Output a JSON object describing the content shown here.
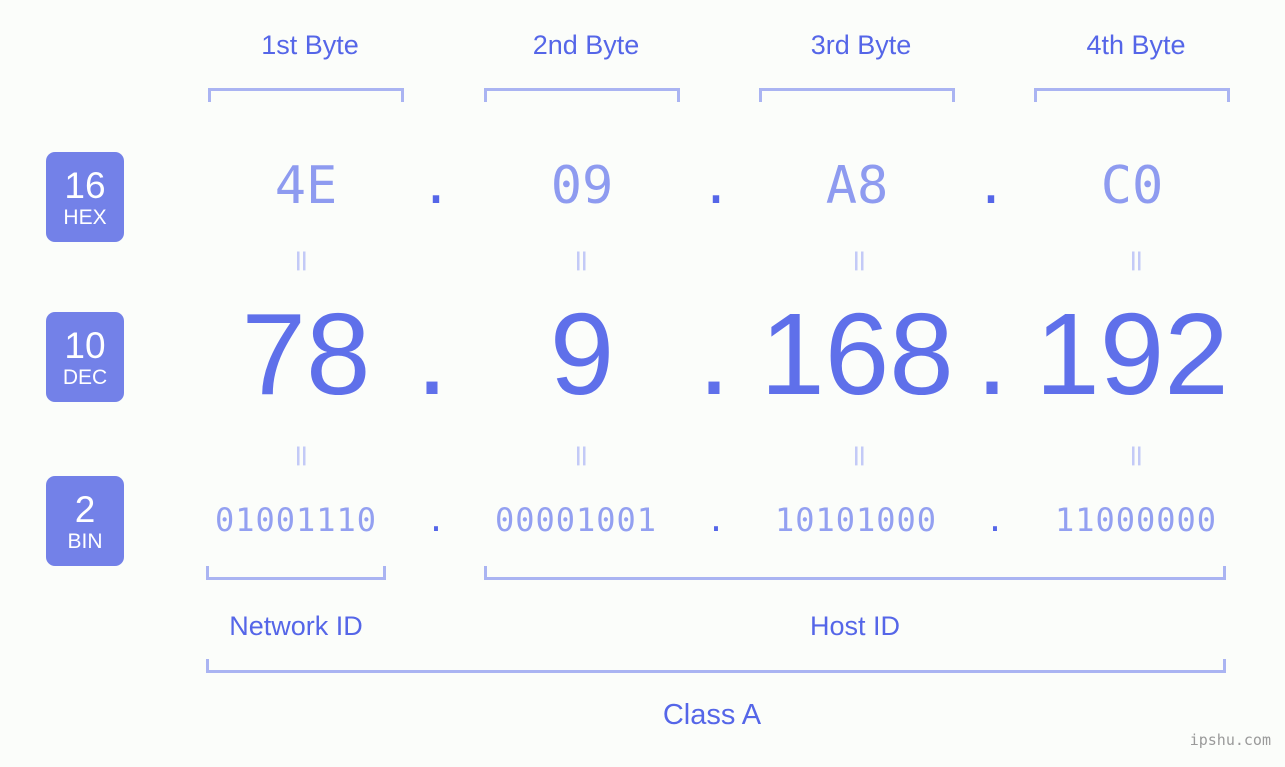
{
  "page": {
    "background_color": "#fbfdfa",
    "accent_color": "#5566e8",
    "badge_color": "#7381e8",
    "bracket_color": "#aab4f2",
    "muted_color": "#8e9bf0"
  },
  "byte_headers": [
    {
      "label": "1st Byte"
    },
    {
      "label": "2nd Byte"
    },
    {
      "label": "3rd Byte"
    },
    {
      "label": "4th Byte"
    }
  ],
  "radix_badges": [
    {
      "number": "16",
      "unit": "HEX"
    },
    {
      "number": "10",
      "unit": "DEC"
    },
    {
      "number": "2",
      "unit": "BIN"
    }
  ],
  "rows": {
    "hex": {
      "values": [
        "4E",
        "09",
        "A8",
        "C0"
      ],
      "separator": "."
    },
    "dec": {
      "values": [
        "78",
        "9",
        "168",
        "192"
      ],
      "separator": "."
    },
    "bin": {
      "values": [
        "01001110",
        "00001001",
        "10101000",
        "11000000"
      ],
      "separator": "."
    }
  },
  "equality_mark": "=",
  "sections": {
    "network_id": "Network ID",
    "host_id": "Host ID",
    "class": "Class A"
  },
  "watermark": "ipshu.com"
}
